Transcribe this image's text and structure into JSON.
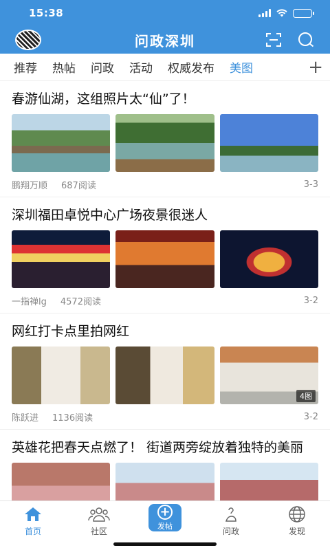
{
  "status_bar": {
    "time": "15:38"
  },
  "header": {
    "title": "问政深圳",
    "scan_icon": "scan-icon",
    "search_icon": "search-icon"
  },
  "tabs": [
    {
      "label": "推荐",
      "active": false
    },
    {
      "label": "热帖",
      "active": false
    },
    {
      "label": "问政",
      "active": false
    },
    {
      "label": "活动",
      "active": false
    },
    {
      "label": "权威发布",
      "active": false
    },
    {
      "label": "美图",
      "active": true
    }
  ],
  "tabs_more_label": "+",
  "posts": [
    {
      "title": "春游仙湖，这组照片太“仙”了！",
      "author": "鹏翔万顺",
      "reads": "687阅读",
      "date": "3-3",
      "image_badge": ""
    },
    {
      "title": "深圳福田卓悦中心广场夜景很迷人",
      "author": "一指禅lg",
      "reads": "4572阅读",
      "date": "3-2",
      "image_badge": ""
    },
    {
      "title": "网红打卡点里拍网红",
      "author": "陈跃进",
      "reads": "1136阅读",
      "date": "3-2",
      "image_badge": "4图"
    },
    {
      "title": "英雄花把春天点燃了！ 街道两旁绽放着独特的美丽",
      "author": "",
      "reads": "",
      "date": "",
      "image_badge": ""
    }
  ],
  "bottom_nav": [
    {
      "label": "首页",
      "icon": "home-icon",
      "active": true
    },
    {
      "label": "社区",
      "icon": "community-icon",
      "active": false
    },
    {
      "label": "发帖",
      "icon": "post-icon",
      "active": false
    },
    {
      "label": "问政",
      "icon": "inquiry-icon",
      "active": false
    },
    {
      "label": "发现",
      "icon": "discover-icon",
      "active": false
    }
  ],
  "colors": {
    "brand": "#3f92dc",
    "active_tab": "#3f92dc"
  }
}
